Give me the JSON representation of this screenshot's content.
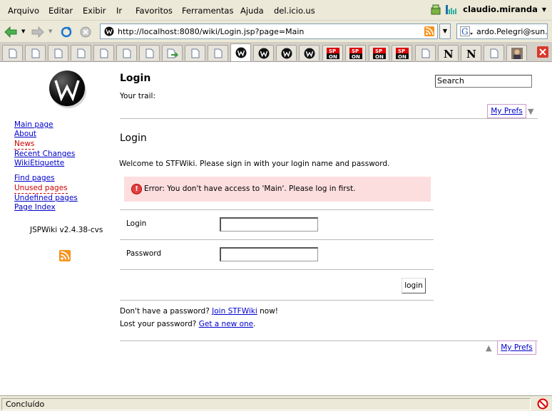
{
  "menubar": {
    "items": [
      {
        "label": "Arquivo"
      },
      {
        "label": "Editar"
      },
      {
        "label": "Exibir"
      },
      {
        "label": "Ir"
      },
      {
        "label": "Favoritos"
      },
      {
        "label": "Ferramentas"
      },
      {
        "label": "Ajuda"
      },
      {
        "label": "del.icio.us"
      }
    ],
    "user": "claudio.miranda"
  },
  "navbar": {
    "url": "http://localhost:8080/wiki/Login.jsp?page=Main",
    "search_value": "ardo.Pelegri@sun.cc"
  },
  "sidebar": {
    "links_group1": [
      {
        "label": "Main page"
      },
      {
        "label": "About"
      },
      {
        "label": "News"
      },
      {
        "label": "Recent Changes"
      },
      {
        "label": "WikiEtiquette"
      }
    ],
    "links_group2": [
      {
        "label": "Find pages"
      },
      {
        "label": "Unused pages"
      },
      {
        "label": "Undefined pages"
      },
      {
        "label": "Page Index"
      }
    ],
    "version": "JSPWiki v2.4.38-cvs"
  },
  "header": {
    "title": "Login",
    "trail": "Your trail:",
    "search_value": "Search",
    "prefs_label": "My Prefs"
  },
  "main": {
    "heading": "Login",
    "welcome": "Welcome to STFWiki. Please sign in with your login name and password.",
    "error": "Error: You don't have access to 'Main'. Please log in first.",
    "login_label": "Login",
    "password_label": "Password",
    "login_button": "login",
    "no_password_prefix": "Don't have a password?",
    "join_link": "Join STFWiki",
    "no_password_suffix": "now!",
    "lost_password_prefix": "Lost your password?",
    "new_one_link": "Get a new one",
    "lost_password_suffix": ".",
    "prefs_label_bottom": "My Prefs"
  },
  "statusbar": {
    "text": "Concluído"
  }
}
